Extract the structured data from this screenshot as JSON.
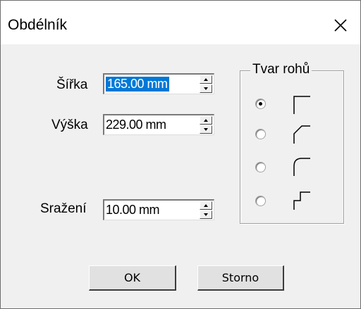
{
  "window": {
    "title": "Obdélník",
    "close_glyph": "✕"
  },
  "fields": {
    "width": {
      "label": "Šířka",
      "value": "165.00 mm"
    },
    "height": {
      "label": "Výška",
      "value": "229.00 mm"
    },
    "chamfer": {
      "label": "Sražení",
      "value": "10.00 mm"
    }
  },
  "corner_shape": {
    "label": "Tvar rohů",
    "options": [
      {
        "icon": "square-corner-icon",
        "selected": true
      },
      {
        "icon": "chamfered-corner-icon",
        "selected": false
      },
      {
        "icon": "rounded-corner-icon",
        "selected": false
      },
      {
        "icon": "stepped-corner-icon",
        "selected": false
      }
    ]
  },
  "buttons": {
    "ok_label": "OK",
    "cancel_label": "Storno"
  },
  "colors": {
    "selection": "#0078d7",
    "dialog_bg": "#f0f0f0"
  }
}
